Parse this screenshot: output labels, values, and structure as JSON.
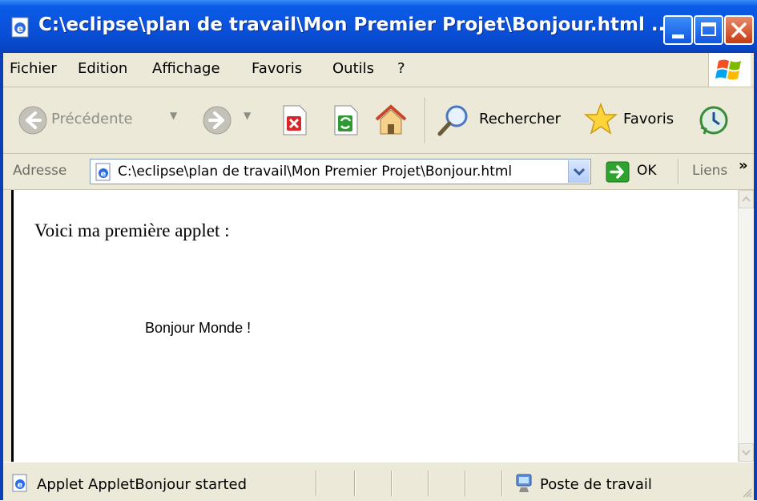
{
  "window": {
    "title": "C:\\eclipse\\plan de travail\\Mon Premier Projet\\Bonjour.html ...",
    "controls": [
      "minimize",
      "maximize",
      "close"
    ]
  },
  "menu": {
    "items": [
      "Fichier",
      "Edition",
      "Affichage",
      "Favoris",
      "Outils",
      "?"
    ]
  },
  "toolbar": {
    "back_label": "Précédente",
    "search_label": "Rechercher",
    "favorites_label": "Favoris"
  },
  "address": {
    "label": "Adresse",
    "value": "C:\\eclipse\\plan de travail\\Mon Premier Projet\\Bonjour.html",
    "go_label": "OK",
    "links_label": "Liens",
    "more_glyph": "»"
  },
  "page": {
    "intro_text": "Voici ma première applet :",
    "applet_text": "Bonjour Monde !"
  },
  "status": {
    "message": "Applet AppletBonjour started",
    "zone": "Poste de travail"
  },
  "colors": {
    "titlebar": "#0a52dc",
    "chrome": "#ece9d8",
    "close_button": "#c43b16",
    "go_arrow": "#2fa330"
  },
  "icons": [
    "ie-page-icon",
    "windows-flag-icon",
    "back-arrow-icon",
    "forward-arrow-icon",
    "stop-icon",
    "refresh-icon",
    "home-icon",
    "search-magnifier-icon",
    "favorites-star-icon",
    "history-icon",
    "go-arrow-icon",
    "computer-zone-icon"
  ]
}
